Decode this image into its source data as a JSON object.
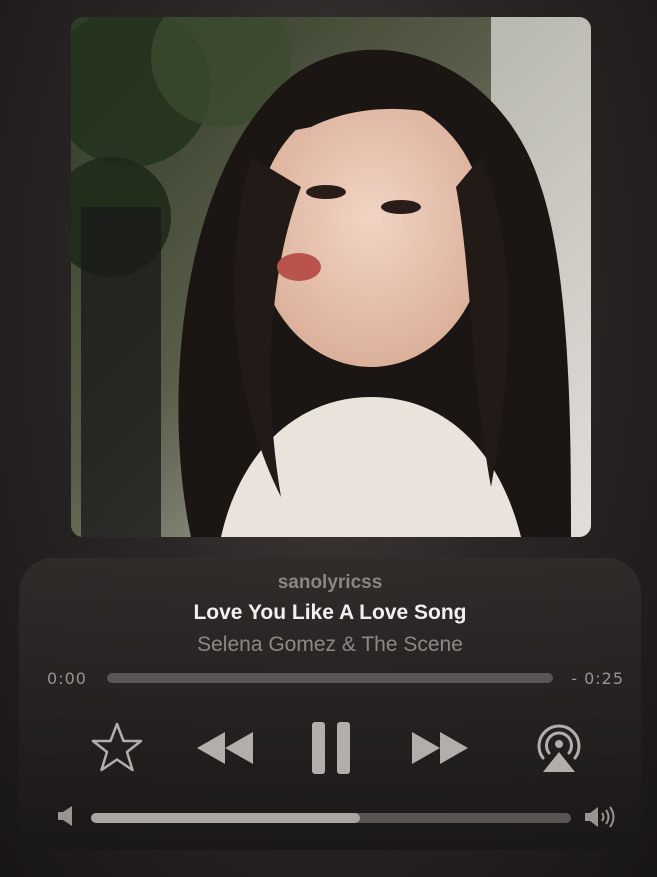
{
  "player": {
    "uploader": "sanolyricss",
    "song_title": "Love You Like A Love Song",
    "artist": "Selena Gomez & The Scene",
    "elapsed": "0:00",
    "remaining": "- 0:25",
    "progress_fraction": 0.0,
    "volume_fraction": 0.56
  },
  "controls": {
    "favorite_icon": "star-outline-icon",
    "rewind_icon": "rewind-icon",
    "play_state_icon": "pause-icon",
    "forward_icon": "fast-forward-icon",
    "airplay_icon": "airplay-icon",
    "volume_low_icon": "speaker-low-icon",
    "volume_high_icon": "speaker-high-icon"
  },
  "artwork": {
    "description_icon": "album-artwork"
  },
  "colors": {
    "title": "#f2f0ee",
    "secondary_text": "#8e8884",
    "track": "#5a5552",
    "fill": "#aaa5a1",
    "icons": "#b3aeaa"
  }
}
